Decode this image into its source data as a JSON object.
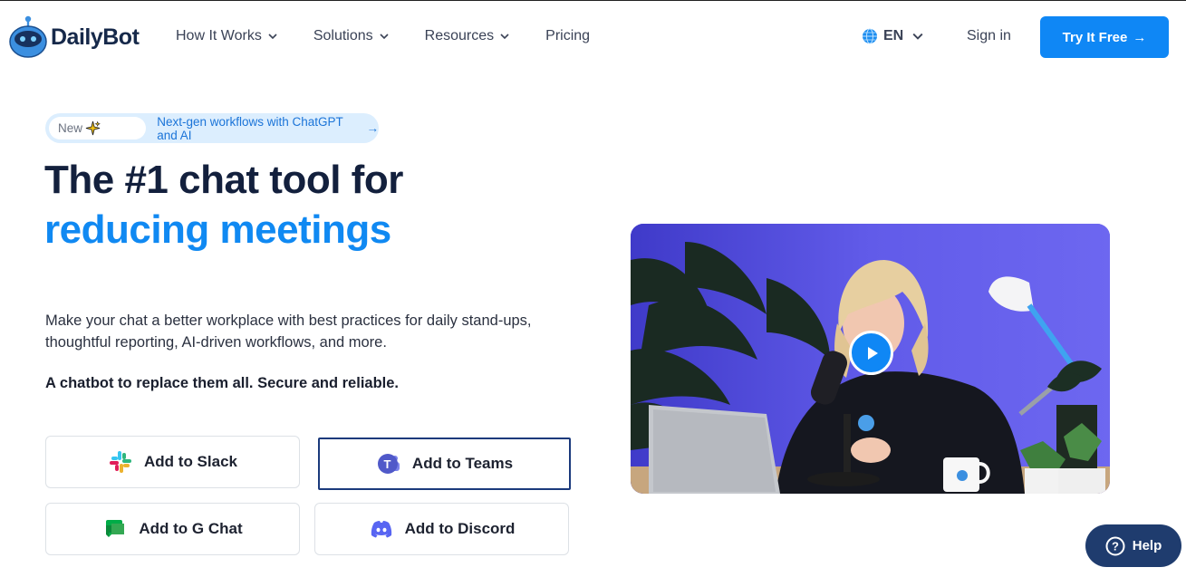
{
  "header": {
    "brand": "DailyBot",
    "nav": [
      {
        "label": "How It Works",
        "has_dropdown": true
      },
      {
        "label": "Solutions",
        "has_dropdown": true
      },
      {
        "label": "Resources",
        "has_dropdown": true
      },
      {
        "label": "Pricing",
        "has_dropdown": false
      }
    ],
    "language": "EN",
    "sign_in": "Sign in",
    "cta": "Try It Free",
    "cta_arrow": "→"
  },
  "announcement": {
    "badge": "New",
    "text": "Next-gen workflows with ChatGPT and AI",
    "arrow": "→"
  },
  "hero": {
    "title_line1": "The #1 chat tool for",
    "title_line2": "reducing meetings",
    "description": "Make your chat a better workplace with best practices for daily stand-ups, thoughtful reporting, AI-driven workflows, and more.",
    "tagline": "A chatbot to replace them all. Secure and reliable."
  },
  "buttons": {
    "slack": "Add to Slack",
    "teams": "Add to Teams",
    "gchat": "Add to G Chat",
    "discord": "Add to Discord"
  },
  "help": {
    "label": "Help",
    "icon": "?"
  },
  "colors": {
    "primary": "#0f87f5",
    "heading": "#13203d",
    "help_bg": "#1f3c6e",
    "pill_bg": "#dceefe"
  }
}
